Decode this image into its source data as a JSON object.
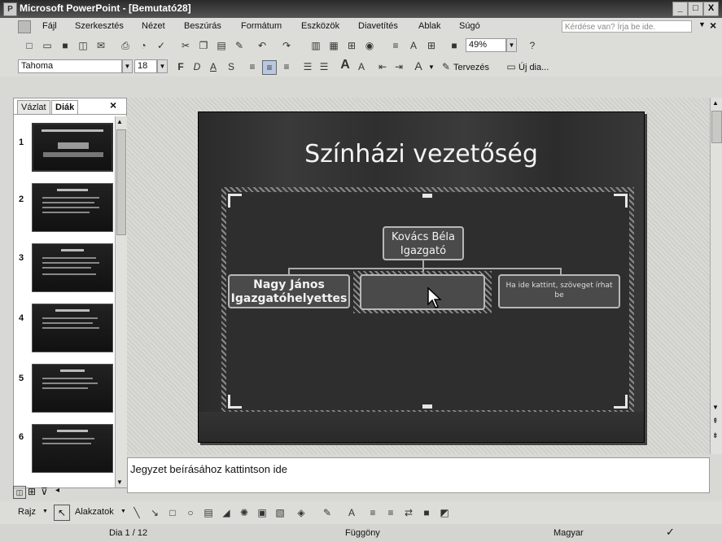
{
  "window": {
    "title": "Microsoft PowerPoint - [Bemutató28]",
    "app_icon": "P",
    "min": "_",
    "max": "□",
    "close": "X"
  },
  "menu": {
    "items": [
      "Fájl",
      "Szerkesztés",
      "Nézet",
      "Beszúrás",
      "Formátum",
      "Eszközök",
      "Diavetítés",
      "Ablak",
      "Súgó"
    ],
    "help_placeholder": "Kérdése van? Írja be ide.",
    "close": "×"
  },
  "standard_toolbar": {
    "zoom": "49%"
  },
  "format_toolbar": {
    "font": "Tahoma",
    "size": "18",
    "design": "Tervezés",
    "new_slide": "Új dia..."
  },
  "left_pane": {
    "tabs": [
      "Vázlat",
      "Diák"
    ],
    "close": "×",
    "thumbnails": [
      "1",
      "2",
      "3",
      "4",
      "5",
      "6"
    ]
  },
  "slide": {
    "title": "Színházi vezetőség",
    "top_node": {
      "line1": "Kovács Béla",
      "line2": "Igazgató"
    },
    "left_node": {
      "line1": "Nagy János",
      "line2": "Igazgatóhelyettes"
    },
    "right_node": {
      "text": "Ha ide kattint, szöveget írhat be"
    }
  },
  "notes": {
    "placeholder": "Jegyzet beírásához kattintson ide"
  },
  "drawing_toolbar": {
    "draw": "Rajz",
    "autoshapes": "Alakzatok"
  },
  "status": {
    "slide": "Dia 1 / 12",
    "design": "Függöny",
    "language": "Magyar"
  },
  "colors": {
    "titlebar": "#2a2a2a",
    "toolbar": "#dcdcd8",
    "slide_bg": "#2f2f2f"
  }
}
